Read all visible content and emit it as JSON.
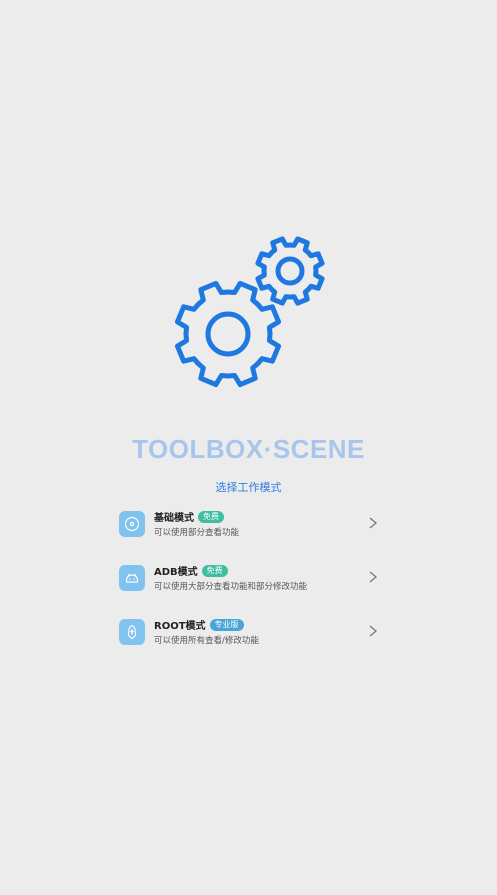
{
  "app": {
    "title": "TOOLBOX·SCENE",
    "subtitle": "选择工作模式"
  },
  "colors": {
    "accent": "#2f7de0",
    "title": "#a8c6ec",
    "icon_bg": "#7fc3ee",
    "badge_free": "#3fbfa0",
    "badge_pro": "#4aa6d8",
    "background": "#ececec"
  },
  "modes": [
    {
      "title": "基础模式",
      "badge": "免费",
      "description": "可以使用部分查看功能",
      "icon": "disc-icon"
    },
    {
      "title": "ADB模式",
      "badge": "免费",
      "description": "可以使用大部分查看功能和部分修改功能",
      "icon": "android-icon"
    },
    {
      "title": "ROOT模式",
      "badge": "专业版",
      "description": "可以使用所有查看/修改功能",
      "icon": "root-icon"
    }
  ]
}
